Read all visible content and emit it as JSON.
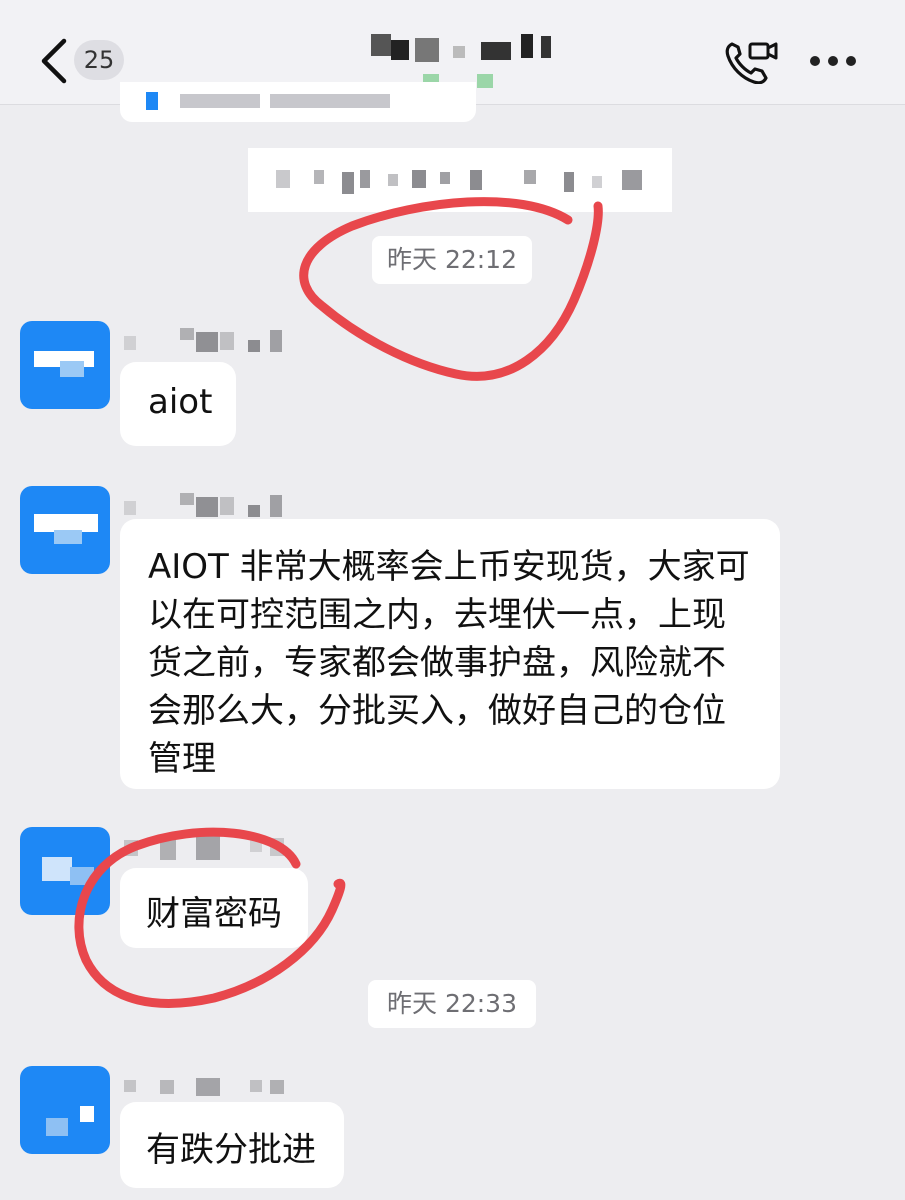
{
  "header": {
    "unread_count": "25",
    "back_icon": "chevron-left-icon",
    "call_icon": "phone-video-icon",
    "more_icon": "more-dots-icon"
  },
  "messages": [
    {
      "timestamp": "昨天 22:12"
    },
    {
      "text": "aiot"
    },
    {
      "text": "AIOT 非常大概率会上币安现货，大家可以在可控范围之内，去埋伏一点，上现货之前，专家都会做事护盘，风险就不会那么大，分批买入，做好自己的仓位管理"
    },
    {
      "text": "财富密码"
    },
    {
      "timestamp": "昨天 22:33"
    },
    {
      "text": "有跌分批进"
    }
  ],
  "colors": {
    "background": "#ededf0",
    "bubble": "#ffffff",
    "avatar": "#1e88f5",
    "annotation": "#e8474c"
  }
}
